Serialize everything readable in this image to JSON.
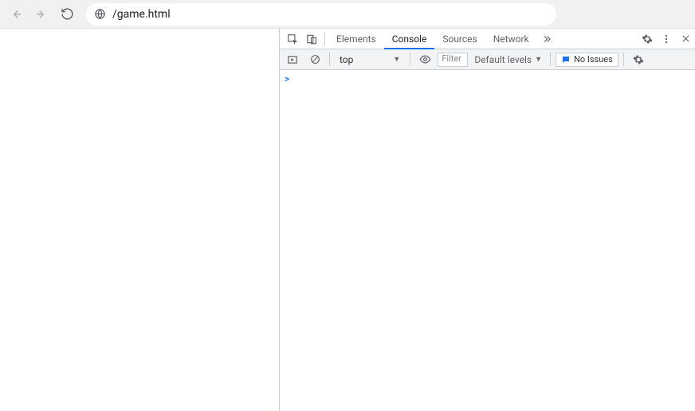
{
  "browser": {
    "url": "/game.html"
  },
  "devtools": {
    "tabs": {
      "elements": "Elements",
      "console": "Console",
      "sources": "Sources",
      "network": "Network"
    },
    "console": {
      "context": "top",
      "filter_placeholder": "Filter",
      "levels_label": "Default levels",
      "issues_label": "No Issues",
      "prompt": ">"
    }
  }
}
